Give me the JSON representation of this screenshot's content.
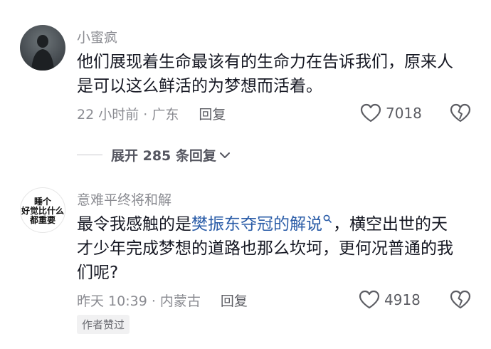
{
  "comments": [
    {
      "username": "小蜜疯",
      "text": "他们展现着生命最该有的生命力在告诉我们，原来人是可以这么鲜活的为梦想而活着。",
      "meta": "22 小时前 · 广东",
      "reply_label": "回复",
      "likes": "7018"
    },
    {
      "username": "意难平终将和解",
      "avatar_text": "睡个好觉比什么都重要",
      "text_before": "最令我感触的是",
      "link_text": "樊振东夺冠的解说",
      "text_after": "，横空出世的天才少年完成梦想的道路也那么坎坷，更何况普通的我们呢?",
      "meta": "昨天 10:39 · 内蒙古",
      "reply_label": "回复",
      "likes": "4918",
      "badge": "作者赞过"
    }
  ],
  "expand_replies_label": "展开 285 条回复",
  "icons": {
    "like": "heart-outline-icon",
    "dislike": "broken-heart-icon",
    "chevron": "chevron-down-icon",
    "search": "search-icon"
  }
}
